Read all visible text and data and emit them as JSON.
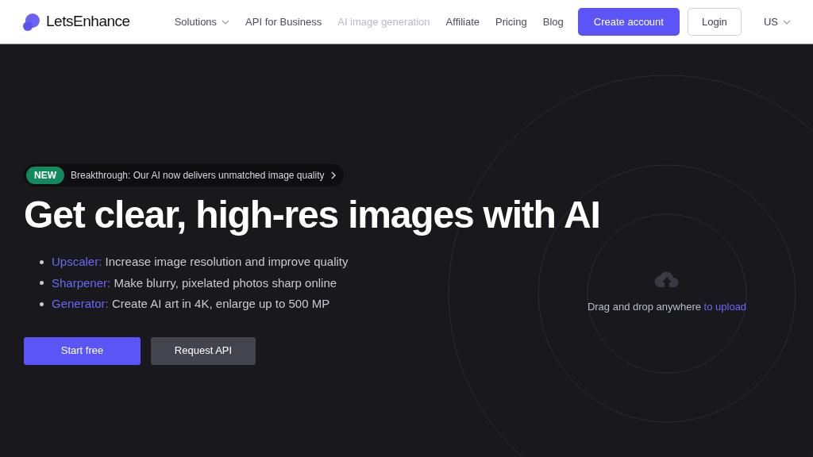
{
  "header": {
    "logo": "LetsEnhance",
    "nav": [
      {
        "label": "Solutions",
        "dropdown": true,
        "dimmed": false
      },
      {
        "label": "API for Business",
        "dropdown": false,
        "dimmed": false
      },
      {
        "label": "AI image generation",
        "dropdown": false,
        "dimmed": true
      },
      {
        "label": "Affiliate",
        "dropdown": false,
        "dimmed": false
      },
      {
        "label": "Pricing",
        "dropdown": false,
        "dimmed": false
      },
      {
        "label": "Blog",
        "dropdown": false,
        "dimmed": false
      }
    ],
    "create_account": "Create account",
    "login": "Login",
    "region": "US"
  },
  "hero": {
    "badge": "NEW",
    "announcement": "Breakthrough: Our AI now delivers unmatched image quality",
    "title": "Get clear, high-res images with AI",
    "features": [
      {
        "term": "Upscaler:",
        "text": "Increase image resolution and improve quality"
      },
      {
        "term": "Sharpener:",
        "text": "Make blurry, pixelated photos sharp online"
      },
      {
        "term": "Generator:",
        "text": "Create AI art in 4K, enlarge up to 500 MP"
      }
    ],
    "buttons": [
      {
        "label": "Start free",
        "kind": "primary"
      },
      {
        "label": "Request API",
        "kind": "secondary"
      }
    ]
  },
  "upload": {
    "text": "Drag and drop anywhere",
    "link": "to upload"
  }
}
